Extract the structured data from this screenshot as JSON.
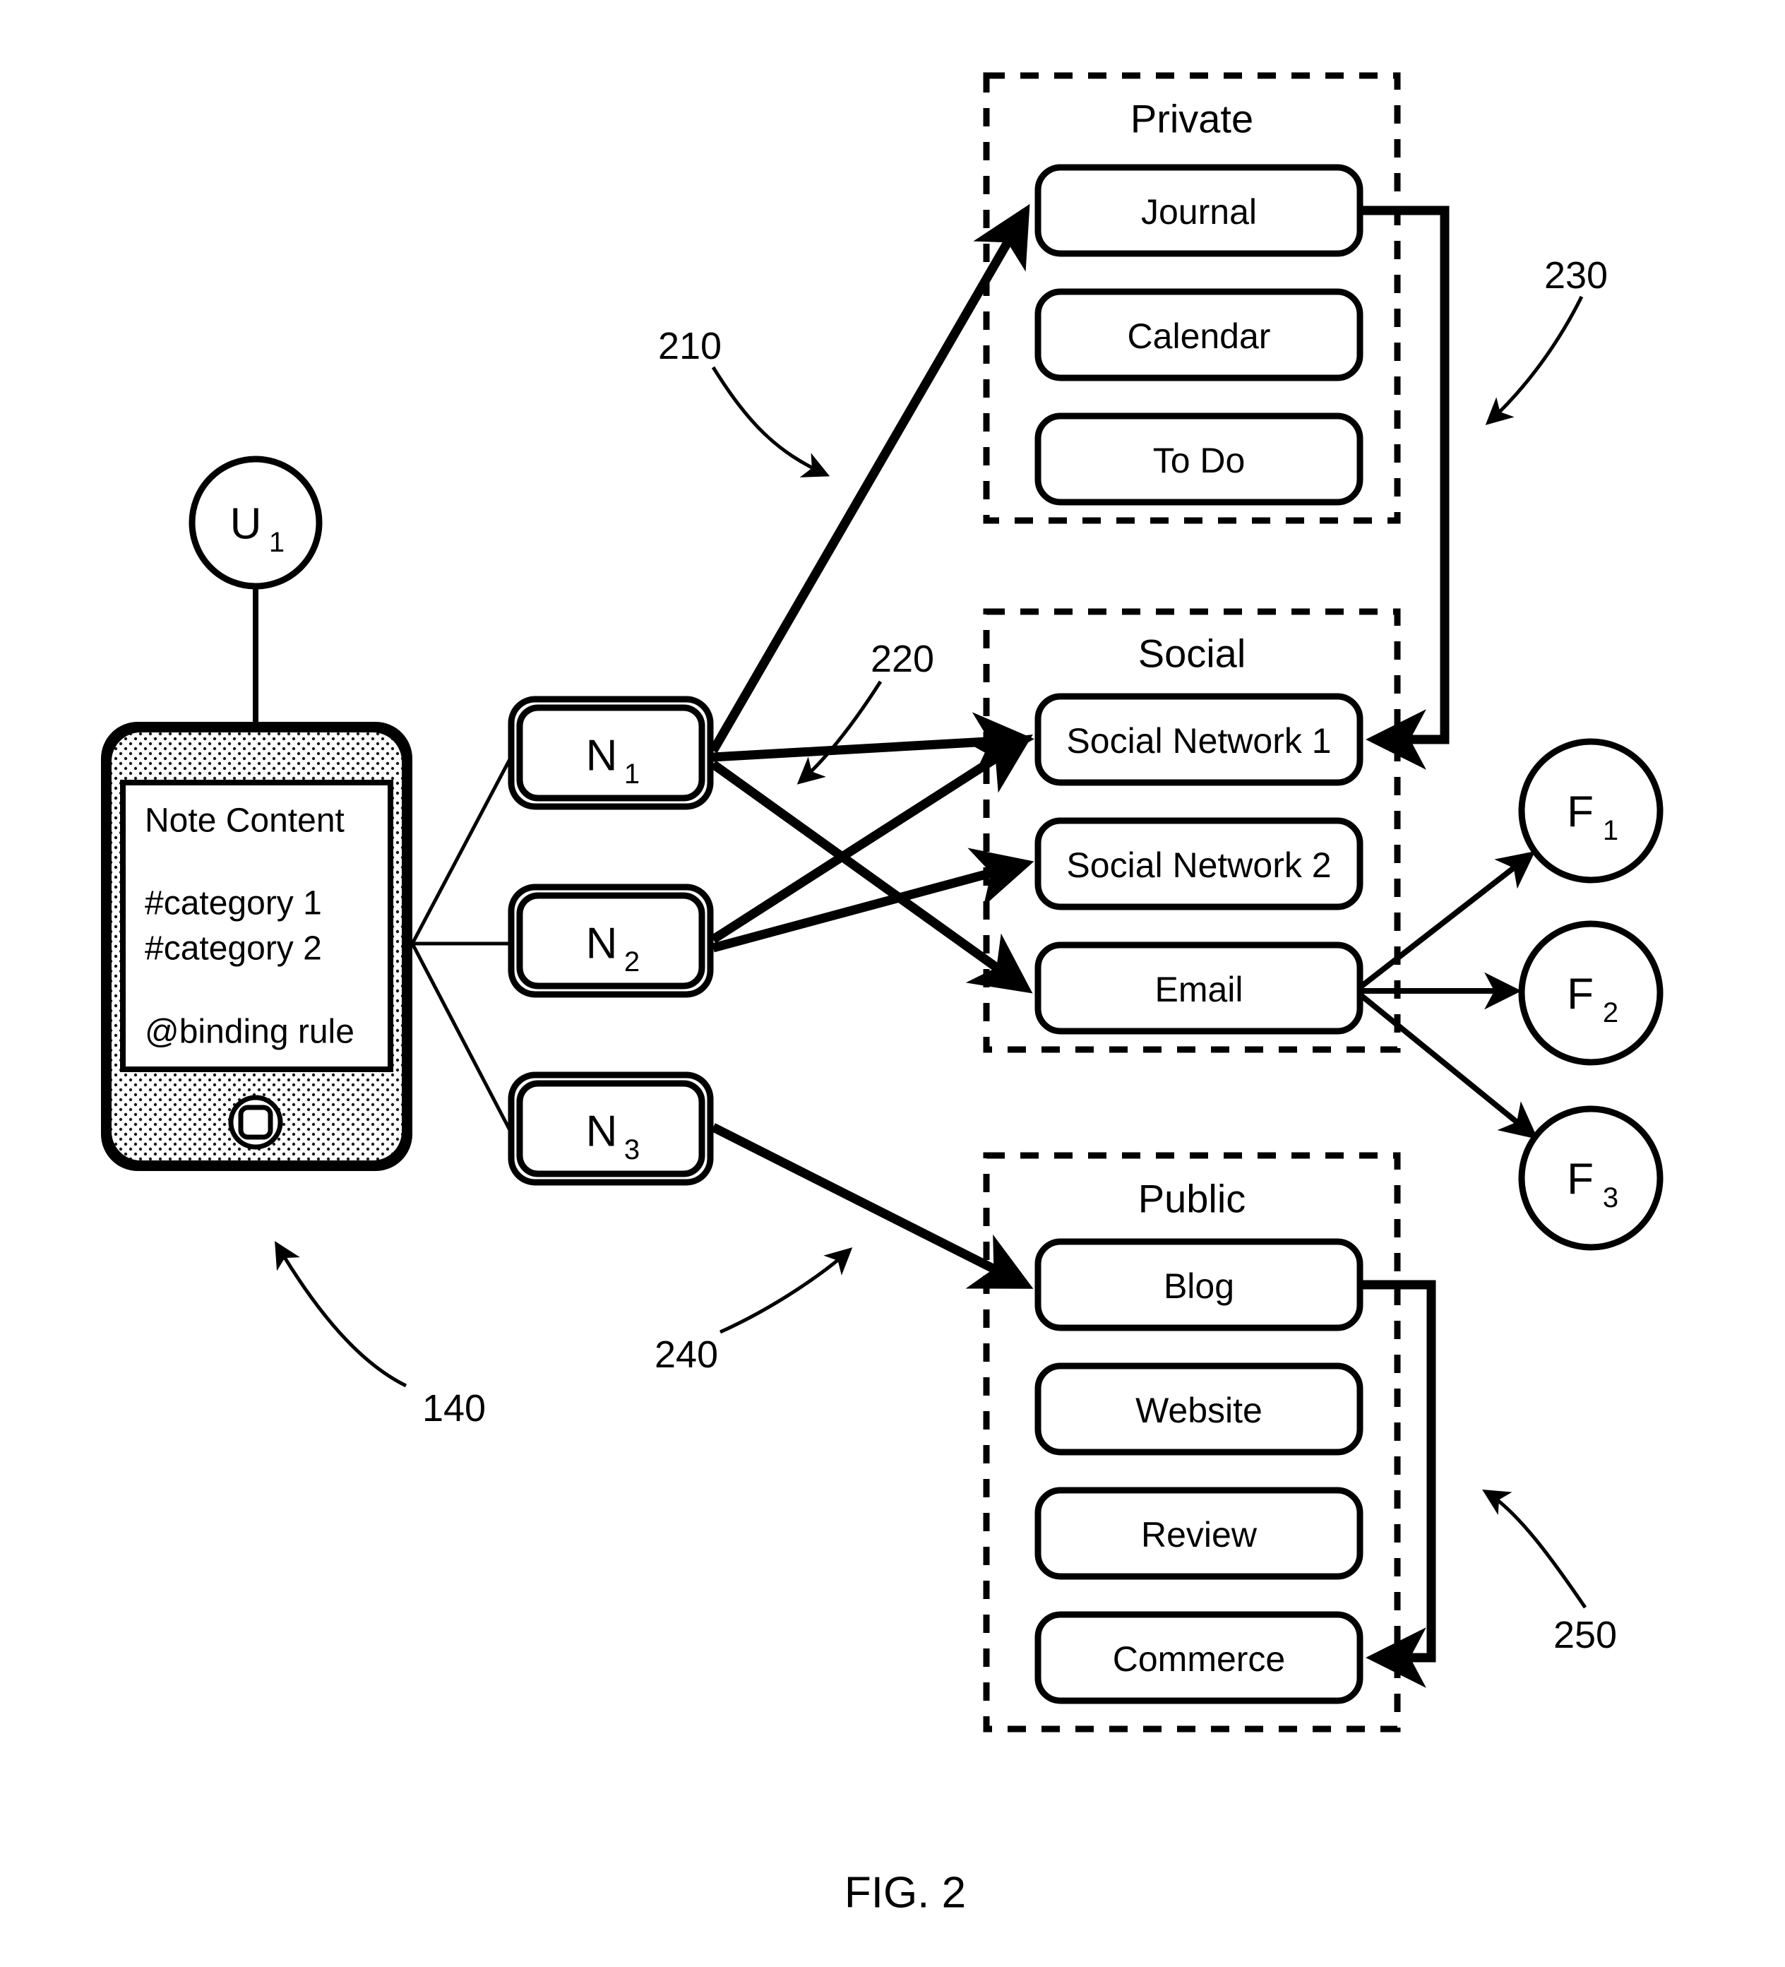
{
  "figure": {
    "caption": "FIG. 2"
  },
  "user": {
    "label": "U",
    "subscript": "1",
    "icon": "user-circle-icon"
  },
  "device": {
    "ref": "140",
    "icon": "smartphone-icon",
    "home_button_icon": "home-button-icon",
    "note": {
      "title": "Note Content",
      "lines": [
        "#category 1",
        "#category 2",
        "@binding rule"
      ]
    }
  },
  "notes": [
    {
      "label": "N",
      "subscript": "1",
      "ref": "210"
    },
    {
      "label": "N",
      "subscript": "2",
      "ref": "220"
    },
    {
      "label": "N",
      "subscript": "3",
      "ref": "240"
    }
  ],
  "groups": [
    {
      "title": "Private",
      "ref": "230",
      "items": [
        "Journal",
        "Calendar",
        "To Do"
      ]
    },
    {
      "title": "Social",
      "ref": "",
      "items": [
        "Social Network 1",
        "Social Network 2",
        "Email"
      ]
    },
    {
      "title": "Public",
      "ref": "250",
      "items": [
        "Blog",
        "Website",
        "Review",
        "Commerce"
      ]
    }
  ],
  "friends": [
    {
      "label": "F",
      "subscript": "1"
    },
    {
      "label": "F",
      "subscript": "2"
    },
    {
      "label": "F",
      "subscript": "3"
    }
  ],
  "reference_numerals": {
    "device": "140",
    "note_1_arrow": "210",
    "note_2_arrow": "220",
    "private_group": "230",
    "note_3_arrow": "240",
    "public_group": "250"
  },
  "colors": {
    "ink": "#000000",
    "paper": "#ffffff",
    "device_body_fill": "#e8e8e8"
  }
}
